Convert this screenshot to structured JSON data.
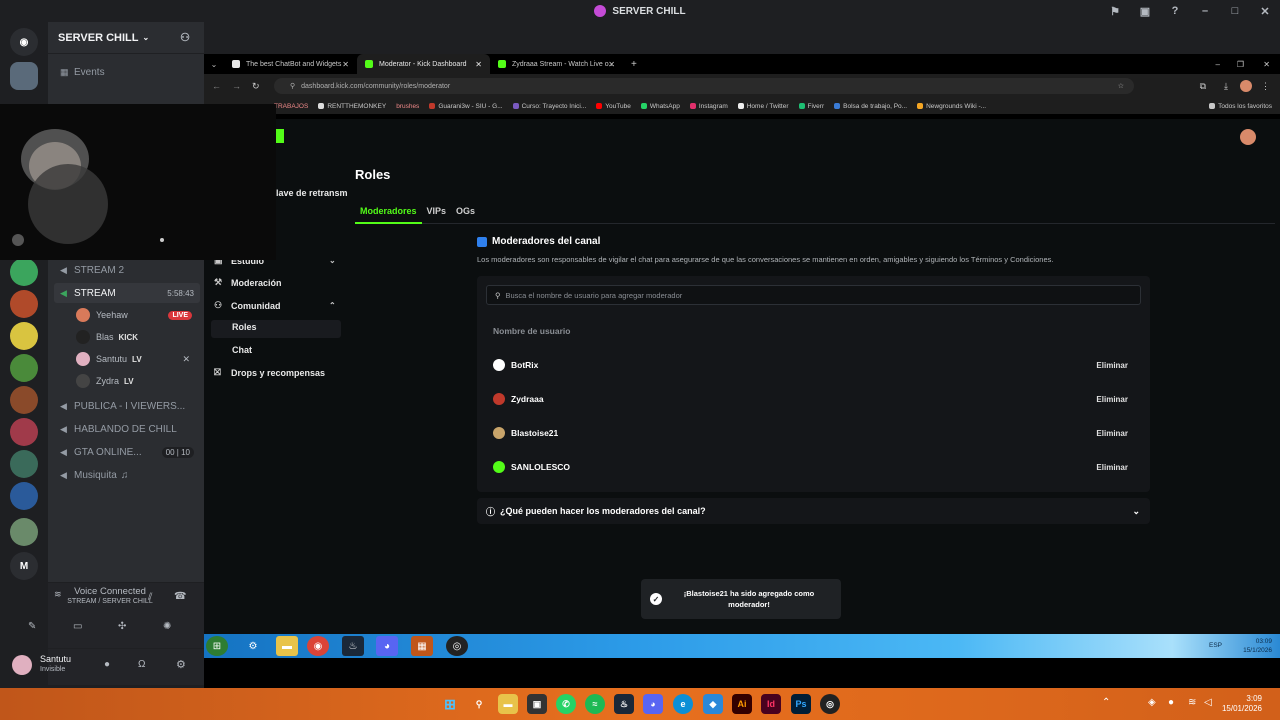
{
  "window": {
    "title": "SERVER CHILL"
  },
  "server": {
    "name": "SERVER CHILL",
    "events_label": "Events"
  },
  "channels": [
    {
      "label": "STREAM 2",
      "active": false
    },
    {
      "label": "STREAM",
      "active": true,
      "timer": "5:58:43"
    },
    {
      "label": "PUBLICA - I VIEWERS...",
      "active": false
    },
    {
      "label": "HABLANDO DE CHILL",
      "active": false
    },
    {
      "label": "GTA ONLINE...",
      "active": false,
      "count_left": "00",
      "count_right": "10"
    },
    {
      "label": "Musiquita",
      "active": false
    }
  ],
  "members": [
    {
      "name": "Yeehaw",
      "badge": "LIVE"
    },
    {
      "name": "Blas",
      "tag": "KICK"
    },
    {
      "name": "Santutu",
      "tag": "LV"
    },
    {
      "name": "Zydra",
      "tag": "LV"
    }
  ],
  "voice": {
    "status": "Voice Connected",
    "location": "STREAM / SERVER CHILL"
  },
  "user": {
    "name": "Santutu",
    "status": "Invisible"
  },
  "browser": {
    "tabs": [
      {
        "title": "The best ChatBot and Widgets",
        "active": false,
        "color": "#e8e8e8"
      },
      {
        "title": "Moderator - Kick Dashboard",
        "active": true,
        "color": "#53fc18"
      },
      {
        "title": "Zydraaa Stream - Watch Live o...",
        "active": false,
        "color": "#53fc18"
      }
    ],
    "url": "dashboard.kick.com/community/roles/moderator",
    "bookmarks": [
      "TRABAJOS",
      "RENTTHEMONKEY",
      "brushes",
      "Guarani3w - SIU - G...",
      "Curso: Trayecto Inici...",
      "YouTube",
      "WhatsApp",
      "Instagram",
      "Home / Twitter",
      "Fiverr",
      "Bolsa de trabajo, Po...",
      "Newgrounds Wiki -...",
      "Todos los favoritos"
    ]
  },
  "kick": {
    "page_title": "Roles",
    "stream_key_partial": "lave de retransm",
    "tabs": [
      "Moderadores",
      "VIPs",
      "OGs"
    ],
    "nav": [
      {
        "label": "Estudio",
        "chevron": "v"
      },
      {
        "label": "Moderación"
      },
      {
        "label": "Comunidad",
        "chevron": "^"
      },
      {
        "label": "Roles",
        "active": true
      },
      {
        "label": "Chat"
      },
      {
        "label": "Drops y recompensas"
      }
    ],
    "section_title": "Moderadores del canal",
    "section_desc": "Los moderadores son responsables de vigilar el chat para asegurarse de que las conversaciones se mantienen en orden, amigables y siguiendo los Términos y Condiciones.",
    "search_placeholder": "Busca el nombre de usuario para agregar moderador",
    "column_header": "Nombre de usuario",
    "moderators": [
      {
        "name": "BotRix",
        "action": "Eliminar",
        "avatar_color": "#ffffff"
      },
      {
        "name": "Zydraaa",
        "action": "Eliminar",
        "avatar_color": "#c0392b"
      },
      {
        "name": "Blastoise21",
        "action": "Eliminar",
        "avatar_color": "#c8a46a"
      },
      {
        "name": "SANLOLESCO",
        "action": "Eliminar",
        "avatar_color": "#53fc18"
      }
    ],
    "faq": "¿Qué pueden hacer los moderadores del canal?",
    "toast": "¡Blastoise21 ha sido agregado como moderador!"
  },
  "inner_tray": {
    "lang": "ESP",
    "time": "03:09",
    "date": "15/1/2026"
  },
  "taskbar": {
    "time": "3:09",
    "date": "15/01/2026"
  }
}
